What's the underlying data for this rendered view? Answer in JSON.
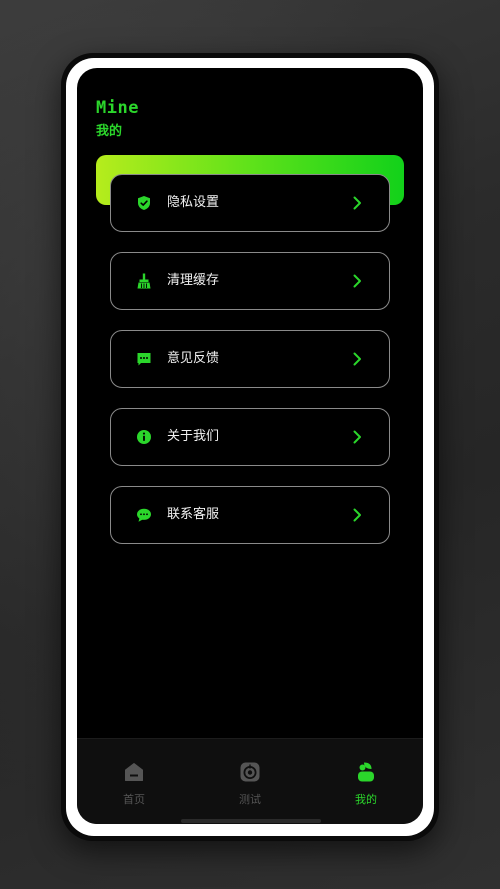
{
  "header": {
    "title_en": "Mine",
    "title_cn": "我的"
  },
  "menu": {
    "items": [
      {
        "label": "隐私设置",
        "icon": "shield-check-icon"
      },
      {
        "label": "清理缓存",
        "icon": "broom-icon"
      },
      {
        "label": "意见反馈",
        "icon": "feedback-message-icon"
      },
      {
        "label": "关于我们",
        "icon": "info-circle-icon"
      },
      {
        "label": "联系客服",
        "icon": "chat-bubble-icon"
      }
    ]
  },
  "tabbar": {
    "tabs": [
      {
        "label": "首页",
        "icon": "home-icon",
        "active": false
      },
      {
        "label": "测试",
        "icon": "test-gauge-icon",
        "active": false
      },
      {
        "label": "我的",
        "icon": "user-icon",
        "active": true
      }
    ]
  },
  "colors": {
    "accent": "#2bd62b",
    "card_gradient_start": "#b6ec1c",
    "card_gradient_end": "#12d11a",
    "inactive_tab": "#555555"
  }
}
